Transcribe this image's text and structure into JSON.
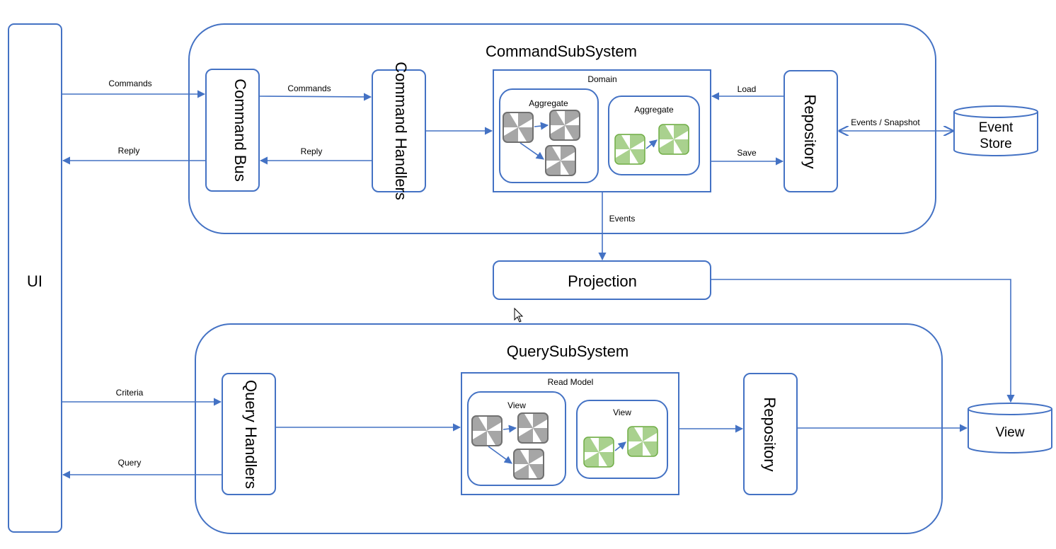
{
  "colors": {
    "stroke": "#4472C4",
    "entity_gray": "#A6A6A6",
    "entity_green": "#A9D18E"
  },
  "ui": {
    "label": "UI"
  },
  "command_subsystem": {
    "title": "CommandSubSystem",
    "command_bus": "Command Bus",
    "command_handlers": "Command Handlers",
    "domain": {
      "label": "Domain",
      "aggregate_1": "Aggregate",
      "aggregate_2": "Aggregate"
    },
    "repository": "Repository",
    "event_store": {
      "line1": "Event",
      "line2": "Store"
    },
    "arrows": {
      "ui_commands": "Commands",
      "ui_reply": "Reply",
      "bus_commands": "Commands",
      "bus_reply": "Reply",
      "load": "Load",
      "save": "Save",
      "events_snapshot": "Events / Snapshot",
      "events": "Events"
    }
  },
  "projection": {
    "label": "Projection"
  },
  "query_subsystem": {
    "title": "QuerySubSystem",
    "query_handlers": "Query Handlers",
    "read_model": {
      "label": "Read Model",
      "view_1": "View",
      "view_2": "View"
    },
    "repository": "Repository",
    "view_store": "View",
    "arrows": {
      "criteria": "Criteria",
      "query": "Query"
    }
  }
}
